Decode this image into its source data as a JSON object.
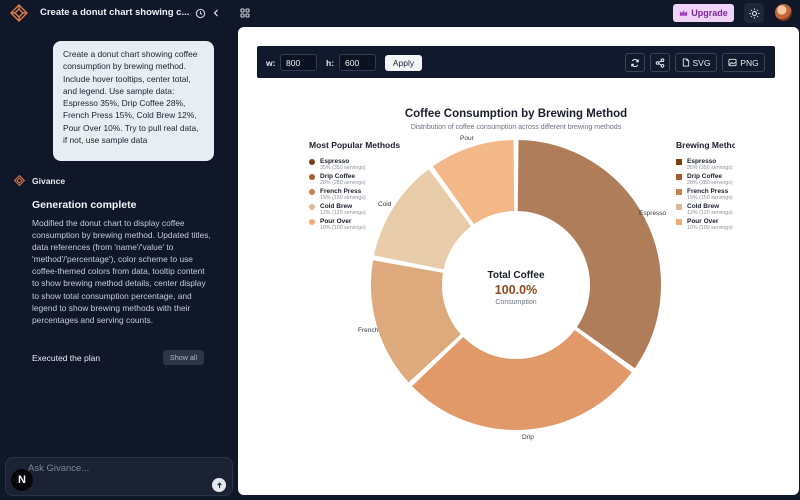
{
  "app": {
    "chat_title": "Create a donut chart showing c...",
    "upgrade_label": "Upgrade"
  },
  "chat": {
    "user_message": "Create a donut chart showing coffee consumption by brewing method. Include hover tooltips, center total, and legend. Use sample data: Espresso 35%, Drip Coffee 28%, French Press 15%, Cold Brew 12%, Pour Over 10%. Try to pull real data, if not, use sample data",
    "agent_name": "Givance",
    "status_title": "Generation complete",
    "status_body": "Modified the donut chart to display coffee consumption by brewing method. Updated titles, data references (from 'name'/'value' to 'method'/'percentage'), color scheme to use coffee-themed colors from data, tooltip content to show brewing method details, center display to show total consumption percentage, and legend to show brewing methods with their percentages and serving counts.",
    "executed_label": "Executed the plan",
    "show_all_label": "Show all",
    "input_placeholder": "Ask Givance...",
    "n_badge": "N"
  },
  "toolbar": {
    "width_label": "w:",
    "width_value": "800",
    "height_label": "h:",
    "height_value": "600",
    "apply_label": "Apply",
    "svg_label": "SVG",
    "png_label": "PNG"
  },
  "chart_data": {
    "type": "pie",
    "title": "Coffee Consumption by Brewing Method",
    "subtitle": "Distribution of coffee consumption across different brewing methods",
    "left_legend_title": "Most Popular Methods",
    "right_legend_title": "Brewing Methods",
    "center": {
      "title": "Total Coffee",
      "value": "100.0%",
      "label": "Consumption"
    },
    "slices": [
      {
        "name": "Espresso",
        "label": "Espresso",
        "value": 35,
        "detail": "35% (350 servings)",
        "color": "#b07d5a"
      },
      {
        "name": "Drip Coffee",
        "label": "Drip",
        "value": 28,
        "detail": "28% (280 servings)",
        "color": "#e1996a"
      },
      {
        "name": "French Press",
        "label": "French",
        "value": 15,
        "detail": "15% (150 servings)",
        "color": "#deaa7d"
      },
      {
        "name": "Cold Brew",
        "label": "Cold",
        "value": 12,
        "detail": "12% (120 servings)",
        "color": "#e8ccaa"
      },
      {
        "name": "Pour Over",
        "label": "Pour",
        "value": 10,
        "detail": "10% (100 servings)",
        "color": "#f2b888"
      }
    ],
    "legend_colors": [
      "#7a3f17",
      "#a85b2e",
      "#c58350",
      "#dcb898",
      "#efac74"
    ]
  }
}
